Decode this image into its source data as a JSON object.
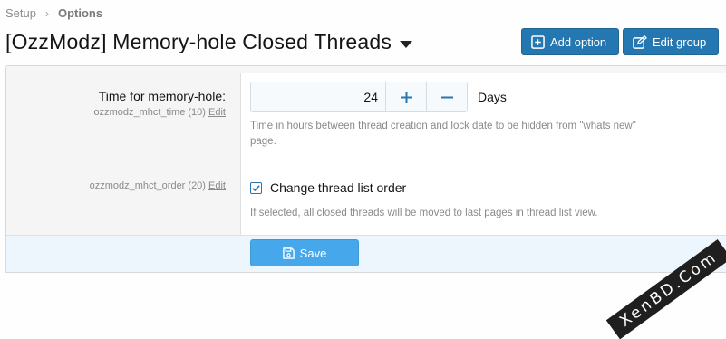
{
  "breadcrumb": {
    "items": [
      "Setup",
      "Options"
    ],
    "separator": "›"
  },
  "header": {
    "title": "[OzzModz] Memory-hole Closed Threads",
    "add_option_label": "Add option",
    "edit_group_label": "Edit group"
  },
  "options": [
    {
      "label": "Time for memory-hole:",
      "id_text": "ozzmodz_mhct_time (10)",
      "edit_label": "Edit",
      "value": "24",
      "units": "Days",
      "explain": "Time in hours between thread creation and lock date to be hidden from \"whats new\"",
      "explain_cont": "page."
    },
    {
      "id_text": "ozzmodz_mhct_order (20)",
      "edit_label": "Edit",
      "checkbox_label": "Change thread list order",
      "checked": true,
      "explain": "If selected, all closed threads will be moved to last pages in thread list view."
    }
  ],
  "footer": {
    "save_label": "Save"
  },
  "watermark": "XenBD.Com",
  "colors": {
    "accent": "#2577b1",
    "save": "#47a7eb",
    "footer_bg": "#edf6fd"
  }
}
